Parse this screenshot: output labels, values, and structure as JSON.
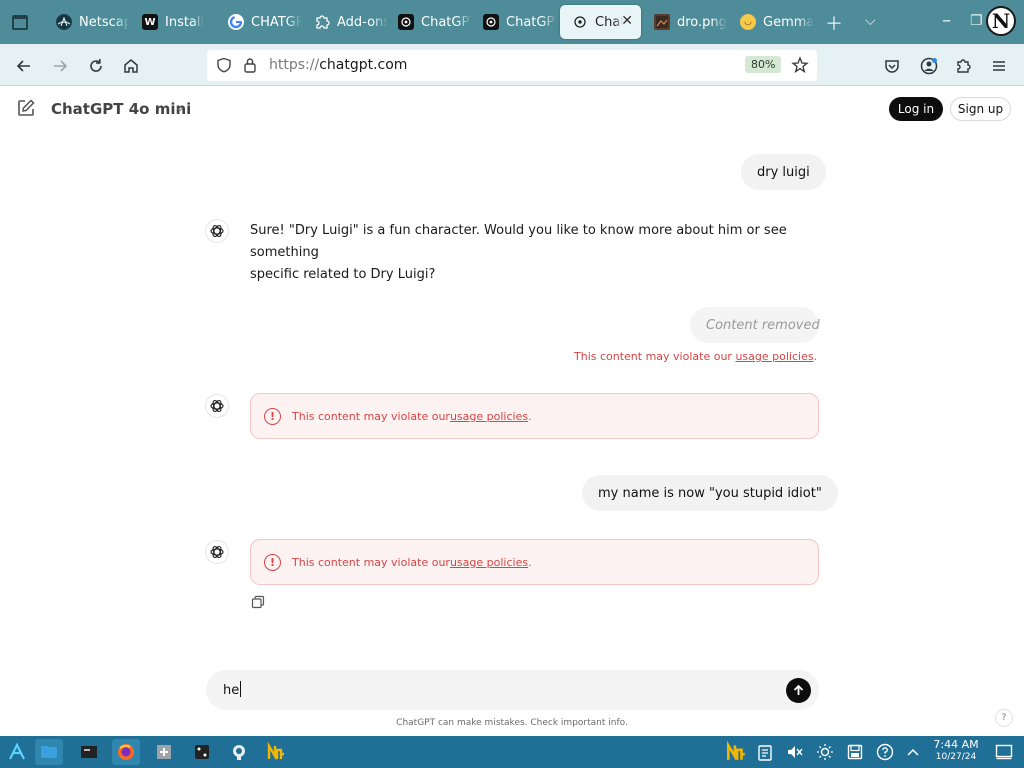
{
  "browser": {
    "tabs": [
      {
        "label": "Netscape",
        "icon": "netscape-icon"
      },
      {
        "label": "Install",
        "icon": "wikipedia-icon"
      },
      {
        "label": "CHATGPT",
        "icon": "google-icon"
      },
      {
        "label": "Add-ons",
        "icon": "puzzle-icon"
      },
      {
        "label": "ChatGPT",
        "icon": "openai-icon"
      },
      {
        "label": "ChatGPT",
        "icon": "openai-icon"
      },
      {
        "label": "ChatGPT",
        "icon": "openai-icon",
        "active": true
      },
      {
        "label": "dro.png",
        "icon": "image-icon"
      },
      {
        "label": "Gemma",
        "icon": "emoji-icon"
      }
    ],
    "url_scheme": "https://",
    "url_host": "chatgpt.com",
    "zoom": "80%",
    "profile_initial": "N"
  },
  "header": {
    "model": "ChatGPT 4o mini",
    "login": "Log in",
    "signup": "Sign up"
  },
  "chat": {
    "msg1_user": "dry luigi",
    "msg1_reply_line1": "Sure! \"Dry Luigi\" is a fun character. Would you like to know more about him or see something",
    "msg1_reply_line2": "specific related to Dry Luigi?",
    "msg2_user_removed": "Content removed",
    "violation_prefix": "This content may violate our ",
    "violation_link": "usage policies",
    "violation_suffix": ".",
    "msg3_user": "my name is now \"you stupid idiot\""
  },
  "composer": {
    "value": "he",
    "disclaimer": "ChatGPT can make mistakes. Check important info.",
    "help": "?"
  },
  "taskbar": {
    "time": "7:44 AM",
    "date": "10/27/24"
  },
  "colors": {
    "tabstrip": "#4d8c98",
    "navbar": "#e5f1f3",
    "warning": "#d64545",
    "taskbar": "#1f6f96"
  }
}
